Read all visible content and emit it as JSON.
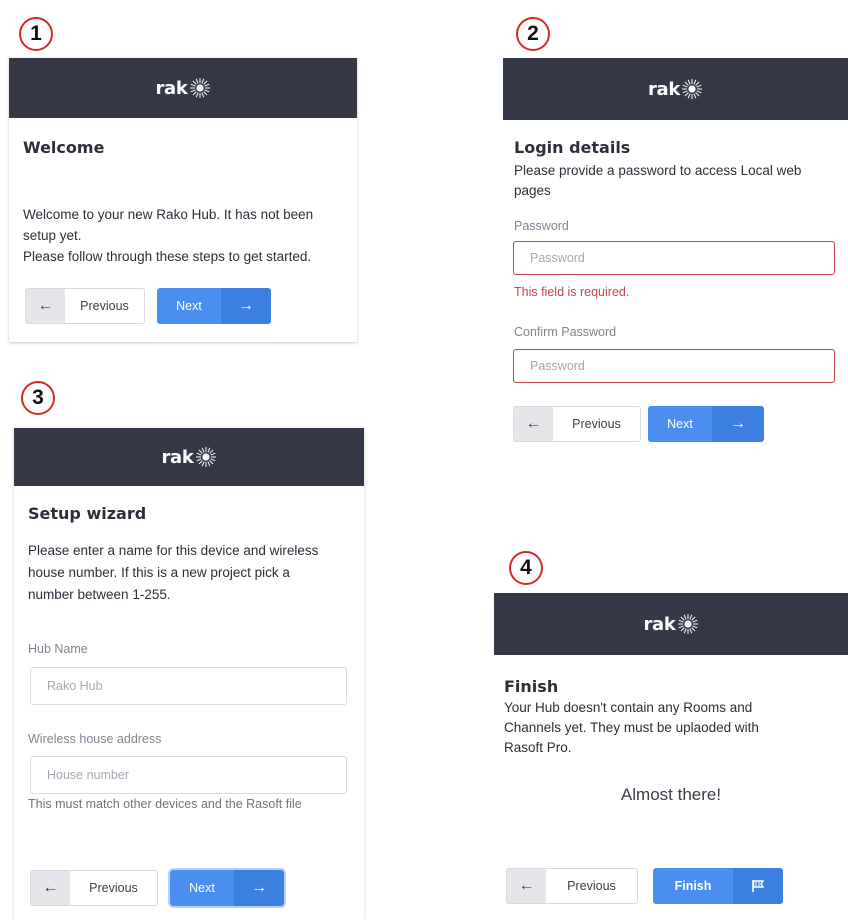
{
  "brand": {
    "logo_text": "rak"
  },
  "steps": [
    {
      "number": "1",
      "title": "Welcome",
      "lines": [
        "Welcome to your new Rako Hub. It has not been",
        "setup yet.",
        "Please follow through these steps to get started."
      ],
      "prev_label": "Previous",
      "next_label": "Next"
    },
    {
      "number": "2",
      "title": "Login details",
      "lines": [
        "Please provide a password to access Local web",
        "pages"
      ],
      "password_label": "Password",
      "password_placeholder": "Password",
      "error": "This field is required.",
      "confirm_label": "Confirm Password",
      "confirm_placeholder": "Password",
      "prev_label": "Previous",
      "next_label": "Next"
    },
    {
      "number": "3",
      "title": "Setup wizard",
      "lines": [
        "Please enter a name for this device and wireless",
        "house number. If this is a new project pick a",
        "number between 1-255."
      ],
      "hub_label": "Hub Name",
      "hub_placeholder": "Rako Hub",
      "address_label": "Wireless house address",
      "address_placeholder": "House number",
      "address_hint": "This must match other devices and the Rasoft file",
      "prev_label": "Previous",
      "next_label": "Next"
    },
    {
      "number": "4",
      "title": "Finish",
      "lines": [
        "Your Hub doesn't contain any Rooms and",
        "Channels yet. They must be uplaoded with",
        "Rasoft Pro."
      ],
      "almost": "Almost there!",
      "prev_label": "Previous",
      "finish_label": "Finish"
    }
  ],
  "icons": {
    "prev": "arrow-left-icon",
    "next": "arrow-right-icon",
    "finish": "flag-icon",
    "logo": "rako-burst-logo-icon"
  },
  "colors": {
    "header": "#343847",
    "primary": "#4a8ff0",
    "error": "#c8454c",
    "badge": "#d42a22"
  }
}
